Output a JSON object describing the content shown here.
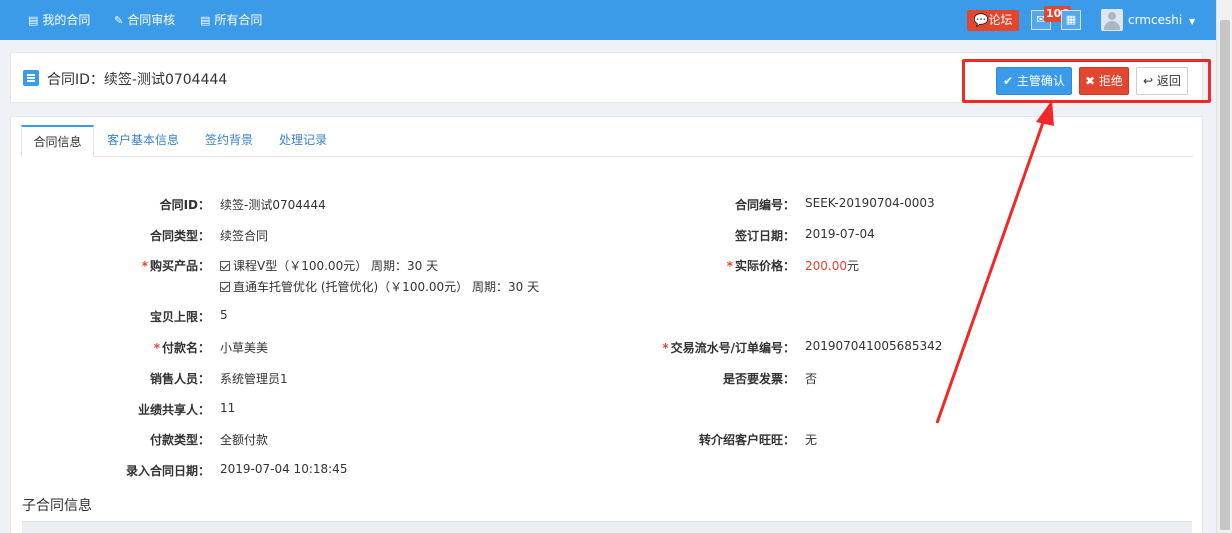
{
  "nav": {
    "items": [
      {
        "label": "我的合同",
        "icon": "contract-list-icon"
      },
      {
        "label": "合同审核",
        "icon": "edit-icon"
      },
      {
        "label": "所有合同",
        "icon": "contracts-icon"
      }
    ],
    "forum_label": "论坛",
    "mail_badge": "106",
    "username": "crmceshi"
  },
  "header": {
    "title": "合同ID：续签-测试0704444",
    "confirm_label": "主管确认",
    "reject_label": "拒绝",
    "back_label": "返回"
  },
  "tabs": [
    "合同信息",
    "客户基本信息",
    "签约背景",
    "处理记录"
  ],
  "fields": {
    "contract_id": {
      "label": "合同ID：",
      "value": "续签-测试0704444"
    },
    "contract_no": {
      "label": "合同编号：",
      "value": "SEEK-20190704-0003"
    },
    "contract_type": {
      "label": "合同类型：",
      "value": "续签合同"
    },
    "sign_date": {
      "label": "签订日期：",
      "value": "2019-07-04"
    },
    "products": {
      "label": "购买产品：",
      "items": [
        "课程V型（￥100.00元）  周期：30 天",
        "直通车托管优化 (托管优化)（￥100.00元）  周期：30 天"
      ]
    },
    "actual_price": {
      "label": "实际价格：",
      "value": "200.00",
      "unit": "元"
    },
    "baby_limit": {
      "label": "宝贝上限：",
      "value": "5"
    },
    "payer": {
      "label": "付款名：",
      "value": "小草美美"
    },
    "trade_no": {
      "label": "交易流水号/订单编号：",
      "value": "201907041005685342"
    },
    "sales": {
      "label": "销售人员：",
      "value": "系统管理员1"
    },
    "invoice": {
      "label": "是否要发票：",
      "value": "否"
    },
    "share": {
      "label": "业绩共享人：",
      "value": "11"
    },
    "pay_type": {
      "label": "付款类型：",
      "value": "全额付款"
    },
    "referral": {
      "label": "转介绍客户旺旺：",
      "value": "无"
    },
    "entry_date": {
      "label": "录入合同日期：",
      "value": "2019-07-04 10:18:45"
    }
  },
  "sub_contract_title": "子合同信息",
  "colors": {
    "nav_bg": "#3c9be8",
    "danger": "#e3462f",
    "annotation": "#f22828"
  }
}
